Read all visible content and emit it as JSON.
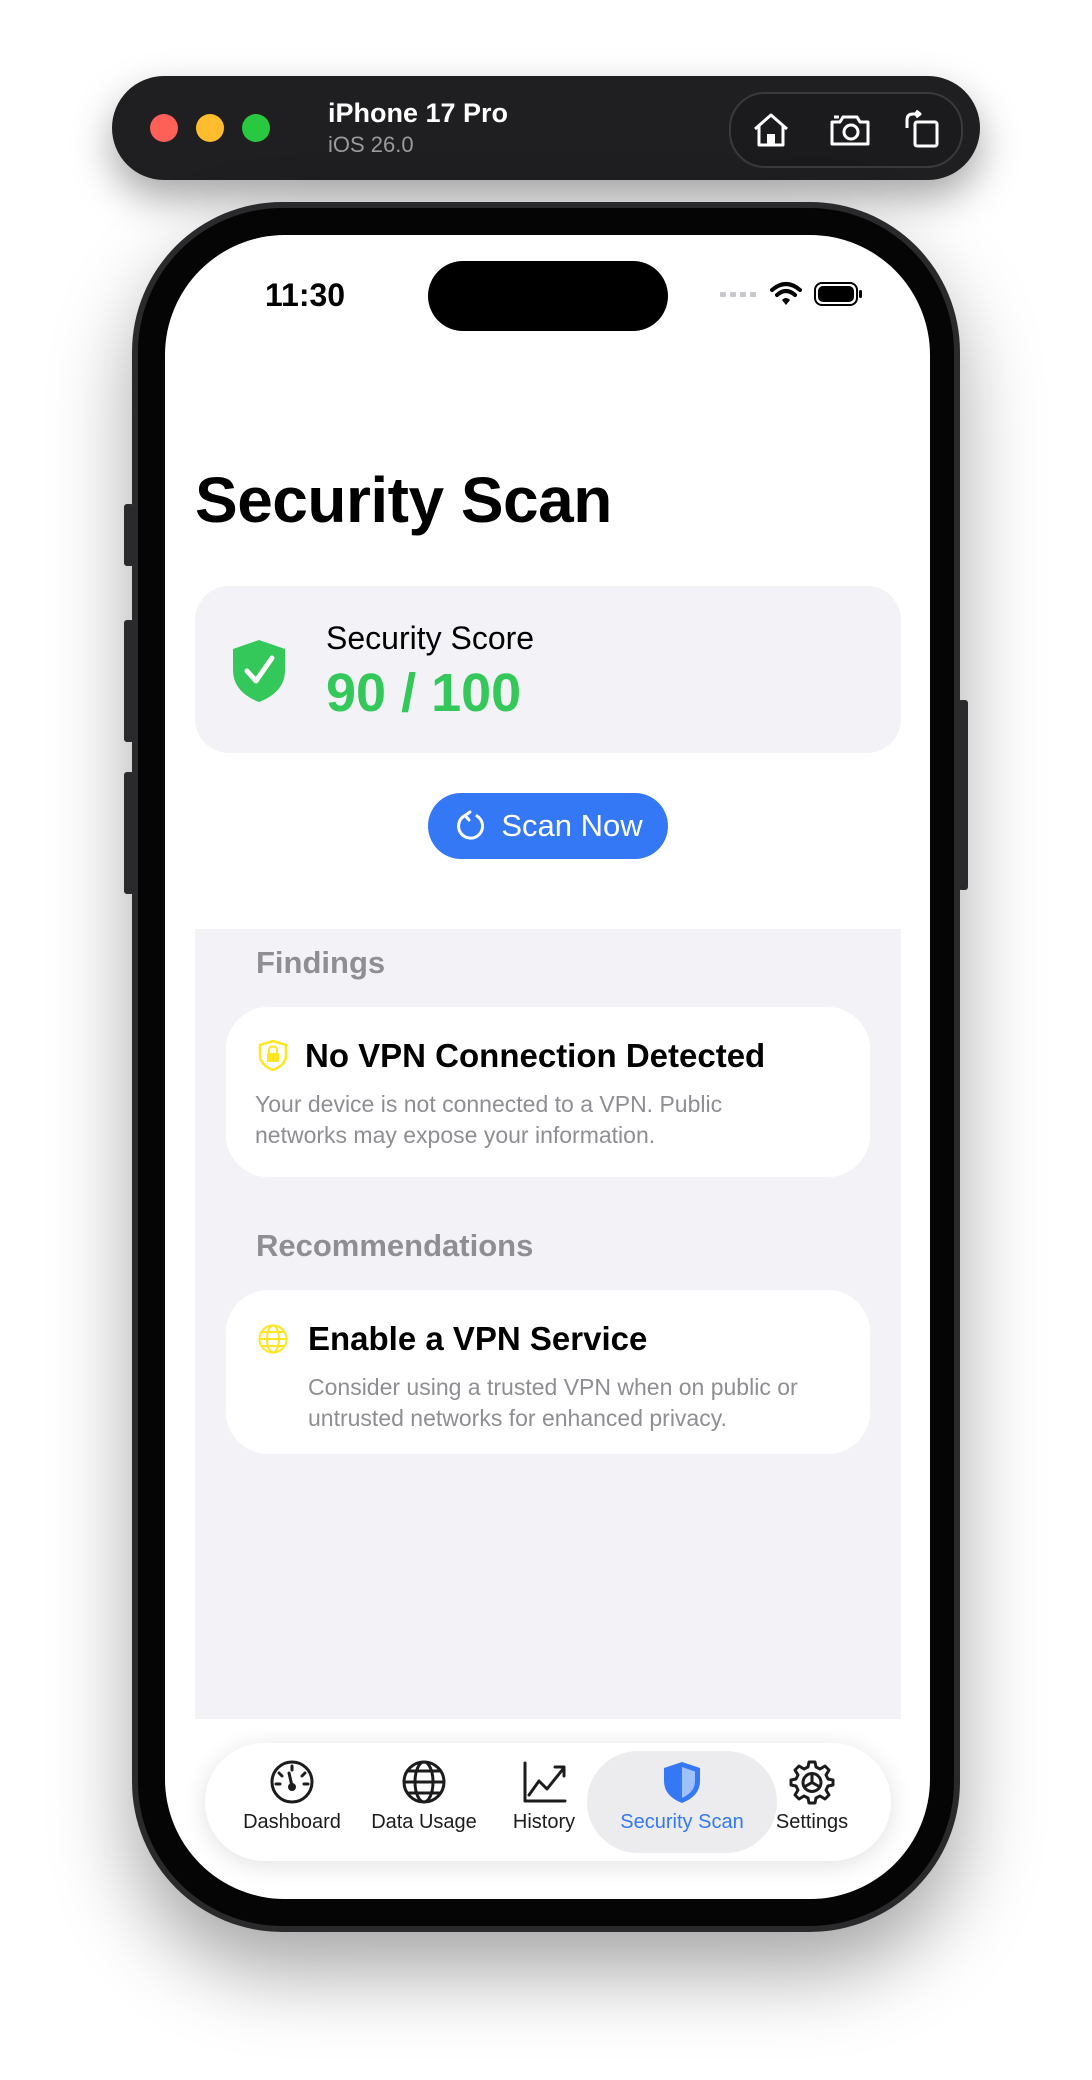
{
  "simulator": {
    "device_name": "iPhone 17 Pro",
    "os_version": "iOS 26.0",
    "tools": [
      "home-icon",
      "screenshot-icon",
      "rotate-icon"
    ]
  },
  "status_bar": {
    "time": "11:30"
  },
  "page": {
    "title": "Security Scan"
  },
  "score_card": {
    "label": "Security Score",
    "value": "90 / 100",
    "score": 90,
    "max": 100,
    "color": "#34c759"
  },
  "scan_button": {
    "label": "Scan Now",
    "color": "#3478f6"
  },
  "findings": {
    "header": "Findings",
    "items": [
      {
        "icon": "lock-shield-icon",
        "title": "No VPN Connection Detected",
        "description_line1": "Your device is not connected to a VPN. Public",
        "description_line2": "networks may expose your information."
      }
    ]
  },
  "recommendations": {
    "header": "Recommendations",
    "items": [
      {
        "icon": "globe-icon",
        "title": "Enable a VPN Service",
        "description_line1": "Consider using a trusted VPN when on public or",
        "description_line2": "untrusted networks for enhanced privacy."
      }
    ]
  },
  "tab_bar": {
    "tabs": [
      {
        "label": "Dashboard",
        "icon": "gauge-icon"
      },
      {
        "label": "Data Usage",
        "icon": "globe-icon"
      },
      {
        "label": "History",
        "icon": "chart-line-icon"
      },
      {
        "label": "Security Scan",
        "icon": "shield-icon",
        "selected": true
      },
      {
        "label": "Settings",
        "icon": "gear-icon"
      }
    ]
  }
}
